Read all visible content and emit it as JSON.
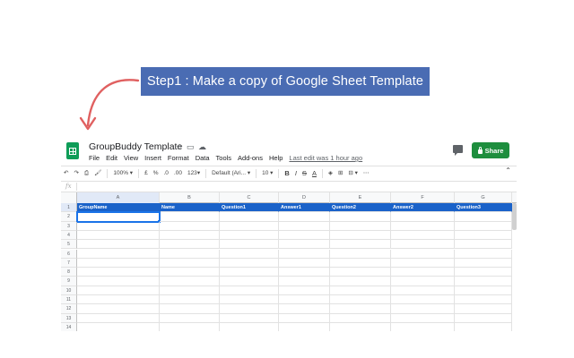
{
  "callout": {
    "text": "Step1 : Make a copy of Google Sheet Template"
  },
  "document": {
    "title": "GroupBuddy Template",
    "title_icons": [
      "star-icon",
      "folder-icon",
      "cloud-icon"
    ],
    "menu": [
      "File",
      "Edit",
      "View",
      "Insert",
      "Format",
      "Data",
      "Tools",
      "Add-ons",
      "Help"
    ],
    "last_edit": "Last edit was 1 hour ago",
    "share_label": "Share"
  },
  "toolbar": {
    "zoom": "100%",
    "currency": "£",
    "percent": "%",
    "decimal_decrease": ".0",
    "decimal_increase": ".00",
    "more_formats": "123",
    "font": "Default (Ari...",
    "font_size": "10",
    "bold": "B",
    "italic": "I",
    "strikethrough": "S",
    "text_color": "A",
    "more": "⋯"
  },
  "formula_bar": {
    "fx": "fx",
    "value": ""
  },
  "grid": {
    "columns": [
      "A",
      "B",
      "C",
      "D",
      "E",
      "F",
      "G"
    ],
    "selected_column": "A",
    "header_row": [
      "GroupName",
      "Name",
      "Question1",
      "Answer1",
      "Question2",
      "Answer2",
      "Question3"
    ],
    "row_numbers": [
      "1",
      "2",
      "3",
      "4",
      "5",
      "6",
      "7",
      "8",
      "9",
      "10",
      "11",
      "12",
      "13",
      "14"
    ],
    "selected_cell": "A2"
  },
  "colors": {
    "callout_bg": "#4a6cb3",
    "header_row_bg": "#1a62c9",
    "share_btn": "#1e8e3e",
    "arrow": "#e06060"
  }
}
